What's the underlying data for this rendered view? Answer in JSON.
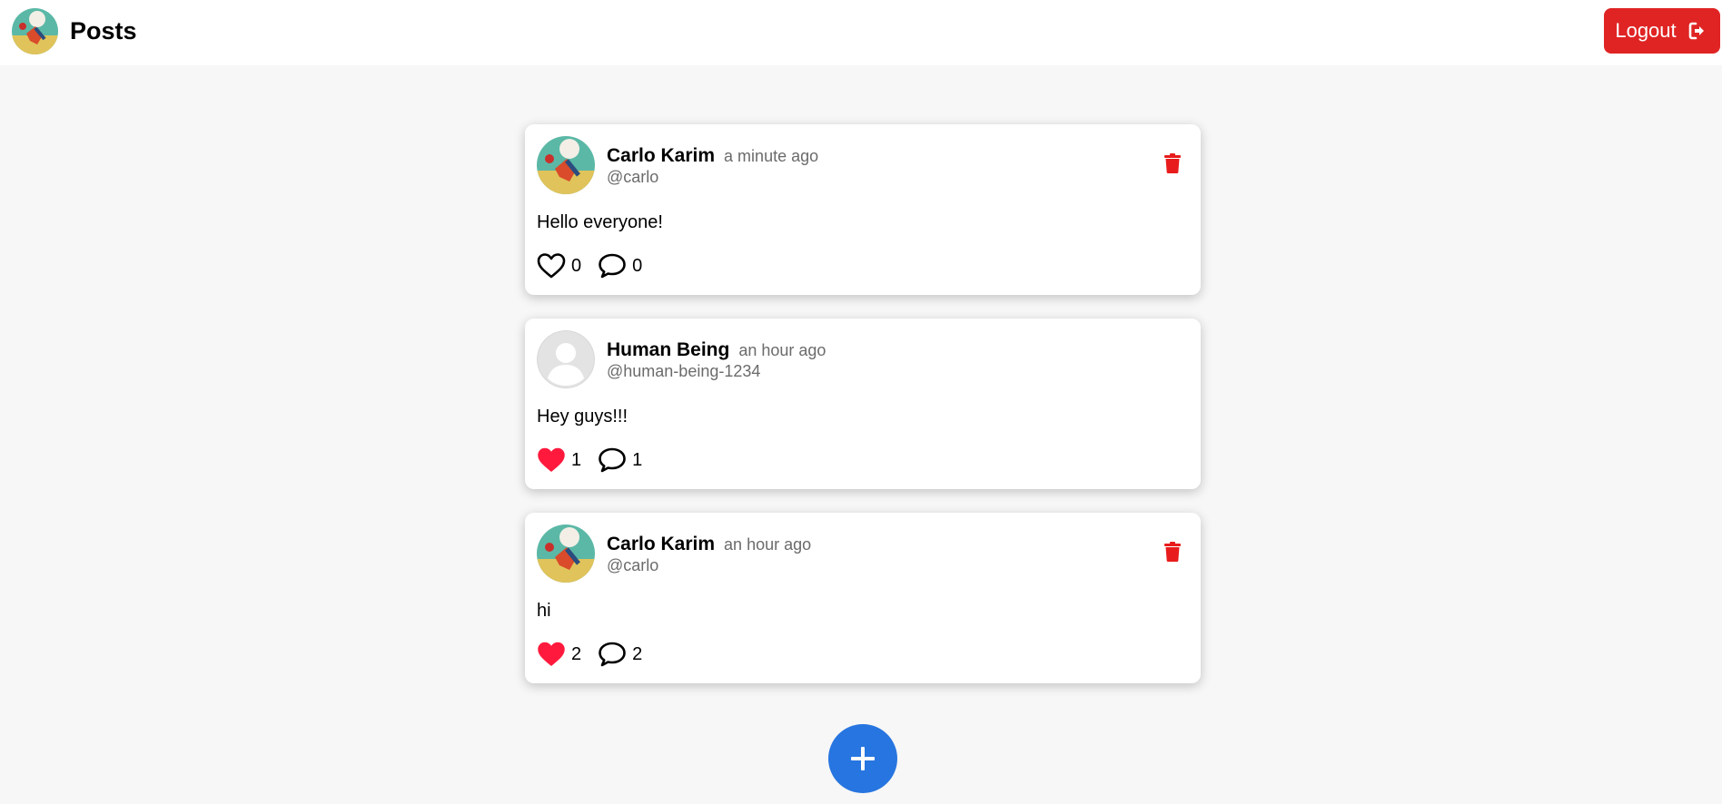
{
  "header": {
    "title": "Posts",
    "logout_label": "Logout"
  },
  "posts": [
    {
      "author": "Carlo Karim",
      "time": "a minute ago",
      "handle": "@carlo",
      "content": "Hello everyone!",
      "likes": "0",
      "comments": "0",
      "liked": false,
      "deletable": true,
      "avatar": "illustrated-avatar"
    },
    {
      "author": "Human Being",
      "time": "an hour ago",
      "handle": "@human-being-1234",
      "content": "Hey guys!!!",
      "likes": "1",
      "comments": "1",
      "liked": true,
      "deletable": false,
      "avatar": "default-avatar"
    },
    {
      "author": "Carlo Karim",
      "time": "an hour ago",
      "handle": "@carlo",
      "content": "hi",
      "likes": "2",
      "comments": "2",
      "liked": true,
      "deletable": true,
      "avatar": "illustrated-avatar"
    }
  ],
  "colors": {
    "logout_bg": "#e02424",
    "fab_bg": "#2775e0",
    "like_active": "#ff1a3d",
    "delete": "#e81c1c"
  },
  "icons": {
    "logout": "sign-out-icon",
    "like": "heart-icon",
    "comment": "comment-bubble-icon",
    "delete": "trash-icon",
    "add": "plus-icon"
  }
}
